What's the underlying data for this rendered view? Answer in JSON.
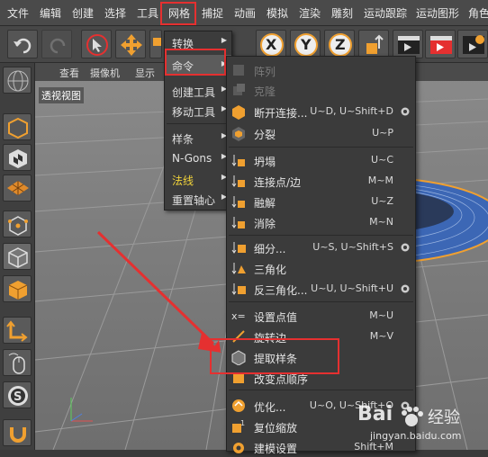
{
  "menubar": {
    "items": [
      "文件",
      "编辑",
      "创建",
      "选择",
      "工具",
      "网格",
      "捕捉",
      "动画",
      "模拟",
      "渲染",
      "雕刻",
      "运动跟踪",
      "运动图形",
      "角色"
    ]
  },
  "viewport": {
    "header_items": [
      "查看",
      "摄像机",
      "显示"
    ],
    "view_label": "透视视图"
  },
  "mesh_menu": {
    "items": [
      {
        "label": "转换",
        "has_submenu": true
      },
      {
        "label": "命令",
        "has_submenu": true,
        "active": true
      },
      {
        "label": "创建工具",
        "has_submenu": true
      },
      {
        "label": "移动工具",
        "has_submenu": true
      },
      {
        "label": "样条",
        "has_submenu": true
      },
      {
        "label": "N-Gons",
        "has_submenu": true
      },
      {
        "label": "法线",
        "has_submenu": true,
        "highlight_color": "#f1d33a"
      },
      {
        "label": "重置轴心",
        "has_submenu": true
      }
    ]
  },
  "command_menu": {
    "items": [
      {
        "label": "阵列",
        "shortcut": "",
        "disabled": true
      },
      {
        "label": "克隆",
        "shortcut": "",
        "disabled": true
      },
      {
        "label": "断开连接...",
        "shortcut": "U~D, U~Shift+D",
        "gear": true
      },
      {
        "label": "分裂",
        "shortcut": "U~P"
      },
      {
        "label": "坍塌",
        "shortcut": "U~C"
      },
      {
        "label": "连接点/边",
        "shortcut": "M~M"
      },
      {
        "label": "融解",
        "shortcut": "U~Z"
      },
      {
        "label": "消除",
        "shortcut": "M~N"
      },
      {
        "label": "细分...",
        "shortcut": "U~S, U~Shift+S",
        "gear": true
      },
      {
        "label": "三角化",
        "shortcut": ""
      },
      {
        "label": "反三角化...",
        "shortcut": "U~U, U~Shift+U",
        "gear": true
      },
      {
        "label": "设置点值",
        "shortcut": "M~U"
      },
      {
        "label": "旋转边",
        "shortcut": "M~V"
      },
      {
        "label": "提取样条",
        "shortcut": ""
      },
      {
        "label": "改变点顺序",
        "shortcut": ""
      },
      {
        "label": "优化...",
        "shortcut": "U~O, U~Shift+O",
        "gear": true
      },
      {
        "label": "复位缩放",
        "shortcut": ""
      },
      {
        "label": "建模设置",
        "shortcut": "Shift+M"
      }
    ]
  },
  "toolbar": {
    "axis_labels": [
      "X",
      "Y",
      "Z"
    ]
  },
  "watermark": {
    "brand": "Bai",
    "brand2": "经验",
    "url": "jingyan.baidu.com"
  },
  "colors": {
    "highlight_box": "#e53030",
    "accent_orange": "#e8952a",
    "menu_bg": "#3b3b3b"
  }
}
